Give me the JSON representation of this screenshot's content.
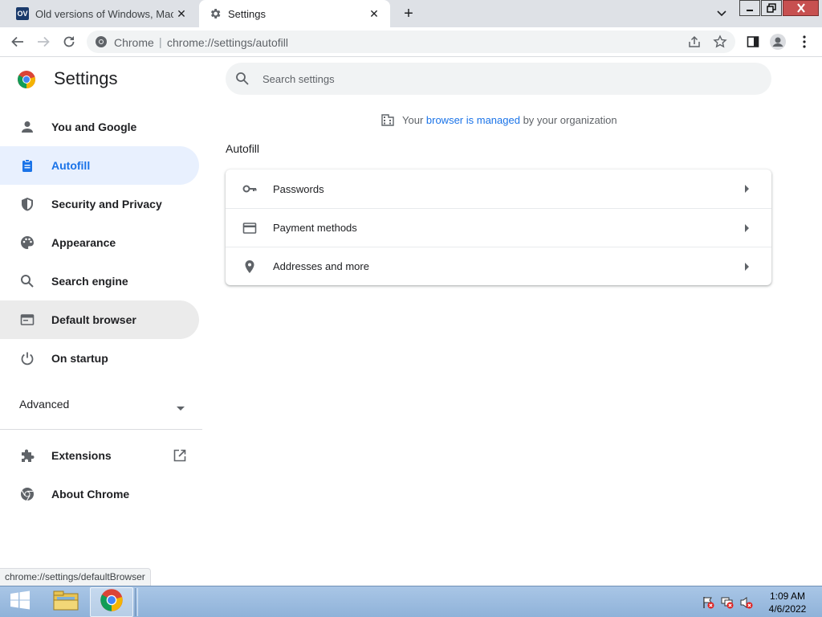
{
  "tabs": [
    {
      "title": "Old versions of Windows, Mac and Linux software",
      "favicon_text": "OV",
      "close": "✕"
    },
    {
      "title": "Settings",
      "close": "✕"
    }
  ],
  "new_tab_label": "+",
  "toolbar": {
    "site_label": "Chrome",
    "separator": "|",
    "url": "chrome://settings/autofill"
  },
  "sidebar": {
    "title": "Settings",
    "items": [
      {
        "label": "You and Google",
        "icon": "person-icon"
      },
      {
        "label": "Autofill",
        "icon": "clipboard-icon",
        "active": true
      },
      {
        "label": "Security and Privacy",
        "icon": "shield-icon"
      },
      {
        "label": "Appearance",
        "icon": "palette-icon"
      },
      {
        "label": "Search engine",
        "icon": "search-icon"
      },
      {
        "label": "Default browser",
        "icon": "browser-icon",
        "hover": true
      },
      {
        "label": "On startup",
        "icon": "power-icon"
      }
    ],
    "advanced_label": "Advanced",
    "extensions_label": "Extensions",
    "about_label": "About Chrome"
  },
  "search": {
    "placeholder": "Search settings"
  },
  "managed": {
    "prefix": "Your ",
    "link": "browser is managed",
    "suffix": " by your organization"
  },
  "section_title": "Autofill",
  "autofill_rows": [
    {
      "label": "Passwords",
      "icon": "key-icon"
    },
    {
      "label": "Payment methods",
      "icon": "credit-card-icon"
    },
    {
      "label": "Addresses and more",
      "icon": "location-pin-icon"
    }
  ],
  "status_url": "chrome://settings/defaultBrowser",
  "taskbar": {
    "time": "1:09 AM",
    "date": "4/6/2022"
  },
  "colors": {
    "accent": "#1a73e8",
    "active_bg": "#e8f0fe",
    "tabstrip_bg": "#dee1e6"
  }
}
